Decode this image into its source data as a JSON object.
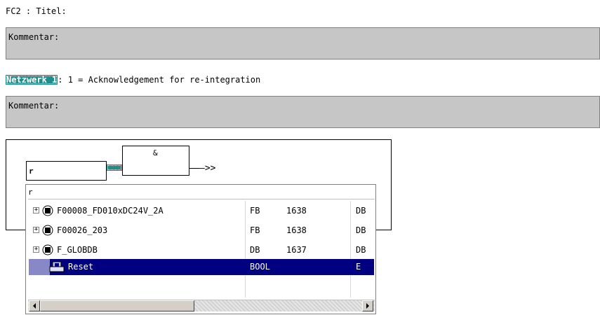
{
  "block_title": "FC2 : Titel:",
  "block_comment": "Kommentar:",
  "network": {
    "badge": "Netzwerk 1",
    "title_text": ": 1 = Acknowledgement for re-integration",
    "comment": "Kommentar:"
  },
  "diagram": {
    "input_value": "r",
    "gate_symbol": "&",
    "output_symbol": "—>>"
  },
  "popup": {
    "filter": "r",
    "rows": [
      {
        "name": "F00008_FD010xDC24V_2A",
        "type": "FB",
        "number": "1638",
        "kind": "DB",
        "icon": "block-icon"
      },
      {
        "name": "F00026_203",
        "type": "FB",
        "number": "1638",
        "kind": "DB",
        "icon": "block-icon"
      },
      {
        "name": "F_GLOBDB",
        "type": "DB",
        "number": "1637",
        "kind": "DB",
        "icon": "block-icon"
      },
      {
        "name": "Reset",
        "type": "BOOL",
        "number": "",
        "kind": "E",
        "icon": "symbol-icon",
        "selected": true
      }
    ]
  },
  "colors": {
    "accent_teal": "#1d8e8e",
    "selection": "#000080",
    "comment_bg": "#c6c6c6"
  }
}
